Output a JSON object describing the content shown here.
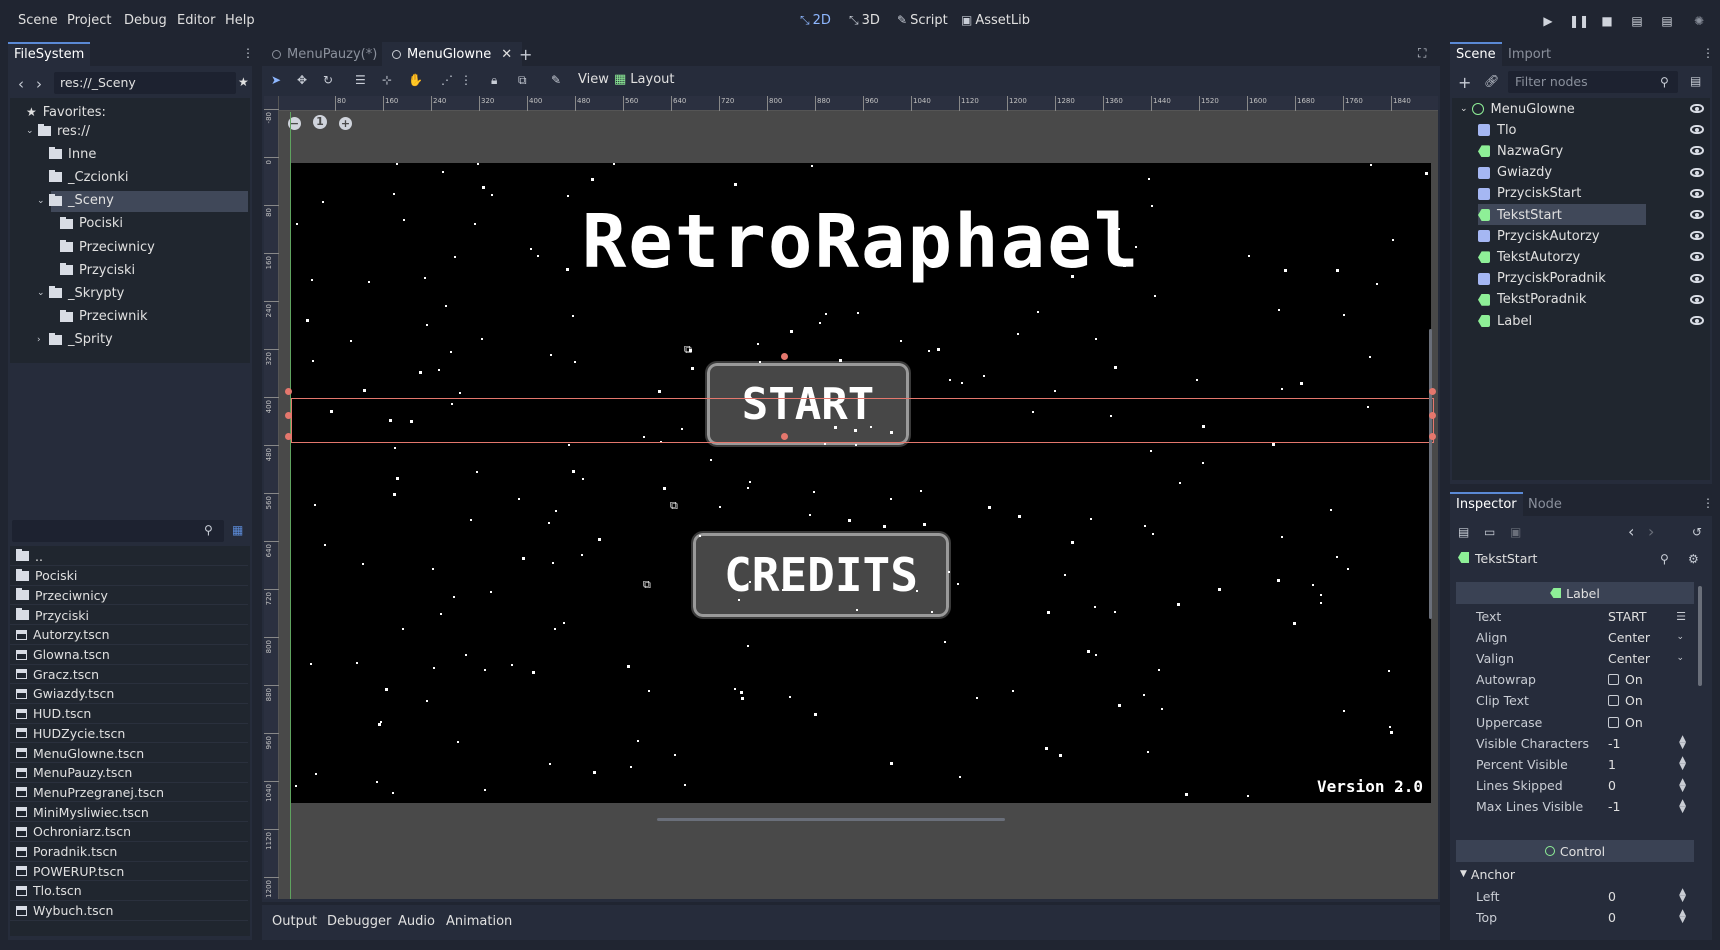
{
  "menu": [
    "Scene",
    "Project",
    "Debug",
    "Editor",
    "Help"
  ],
  "modes": [
    {
      "label": "2D",
      "icon": "2d-icon",
      "active": true
    },
    {
      "label": "3D",
      "icon": "3d-icon",
      "active": false
    },
    {
      "label": "Script",
      "icon": "script-icon",
      "active": false
    },
    {
      "label": "AssetLib",
      "icon": "assetlib-icon",
      "active": false
    }
  ],
  "filesystem": {
    "tab_label": "FileSystem",
    "path": "res://_Sceny",
    "favorites_label": "Favorites:",
    "tree": [
      {
        "label": "res://",
        "depth": 0,
        "expanded": true
      },
      {
        "label": "Inne",
        "depth": 1
      },
      {
        "label": "_Czcionki",
        "depth": 1
      },
      {
        "label": "_Sceny",
        "depth": 1,
        "expanded": true,
        "selected": true
      },
      {
        "label": "Pociski",
        "depth": 2
      },
      {
        "label": "Przeciwnicy",
        "depth": 2
      },
      {
        "label": "Przyciski",
        "depth": 2
      },
      {
        "label": "_Skrypty",
        "depth": 1,
        "expanded": true
      },
      {
        "label": "Przeciwnik",
        "depth": 2
      },
      {
        "label": "_Sprity",
        "depth": 1,
        "collapsed": true
      }
    ],
    "files": [
      {
        "label": "..",
        "kind": "folder"
      },
      {
        "label": "Pociski",
        "kind": "folder"
      },
      {
        "label": "Przeciwnicy",
        "kind": "folder"
      },
      {
        "label": "Przyciski",
        "kind": "folder"
      },
      {
        "label": "Autorzy.tscn",
        "kind": "scene"
      },
      {
        "label": "Glowna.tscn",
        "kind": "scene"
      },
      {
        "label": "Gracz.tscn",
        "kind": "scene"
      },
      {
        "label": "Gwiazdy.tscn",
        "kind": "scene"
      },
      {
        "label": "HUD.tscn",
        "kind": "scene"
      },
      {
        "label": "HUDZycie.tscn",
        "kind": "scene"
      },
      {
        "label": "MenuGlowne.tscn",
        "kind": "scene"
      },
      {
        "label": "MenuPauzy.tscn",
        "kind": "scene"
      },
      {
        "label": "MenuPrzegranej.tscn",
        "kind": "scene"
      },
      {
        "label": "MiniMysliwiec.tscn",
        "kind": "scene"
      },
      {
        "label": "Ochroniarz.tscn",
        "kind": "scene"
      },
      {
        "label": "Poradnik.tscn",
        "kind": "scene"
      },
      {
        "label": "POWERUP.tscn",
        "kind": "scene"
      },
      {
        "label": "Tlo.tscn",
        "kind": "scene"
      },
      {
        "label": "Wybuch.tscn",
        "kind": "scene"
      }
    ]
  },
  "editor_tabs": [
    {
      "label": "MenuPauzy(*)",
      "active": false
    },
    {
      "label": "MenuGlowne",
      "active": true
    }
  ],
  "toolbar": {
    "view_label": "View",
    "layout_label": "Layout"
  },
  "ruler_top": [
    "80",
    "160",
    "240",
    "320",
    "400",
    "480",
    "560",
    "640",
    "720",
    "800",
    "880",
    "960",
    "1040",
    "1120",
    "1200",
    "1280",
    "1360",
    "1440",
    "1520",
    "1600",
    "1680",
    "1760",
    "1840"
  ],
  "ruler_left": [
    "-80",
    "0",
    "80",
    "160",
    "240",
    "320",
    "400",
    "480",
    "560",
    "640",
    "720",
    "800",
    "880",
    "960",
    "1040",
    "1120",
    "1200"
  ],
  "zoom": {
    "reset_label": "1"
  },
  "game": {
    "title": "RetroRaphael",
    "start_label": "START",
    "credits_label": "CREDITS",
    "version": "Version 2.0"
  },
  "bottom_tabs": [
    "Output",
    "Debugger",
    "Audio",
    "Animation"
  ],
  "scene_panel": {
    "tabs": [
      "Scene",
      "Import"
    ],
    "filter_placeholder": "Filter nodes",
    "nodes": [
      {
        "label": "MenuGlowne",
        "type": "control-icon",
        "color": "#8eef97",
        "depth": 0
      },
      {
        "label": "Tlo",
        "type": "texture-rect-icon",
        "color": "#a5b7f3",
        "depth": 1
      },
      {
        "label": "NazwaGry",
        "type": "label-icon",
        "color": "#8eef97",
        "depth": 1
      },
      {
        "label": "Gwiazdy",
        "type": "particles-icon",
        "color": "#a5b7f3",
        "depth": 1
      },
      {
        "label": "PrzyciskStart",
        "type": "texture-button-icon",
        "color": "#a5b7f3",
        "depth": 1
      },
      {
        "label": "TekstStart",
        "type": "label-icon",
        "color": "#8eef97",
        "depth": 1,
        "selected": true
      },
      {
        "label": "PrzyciskAutorzy",
        "type": "texture-button-icon",
        "color": "#a5b7f3",
        "depth": 1
      },
      {
        "label": "TekstAutorzy",
        "type": "label-icon",
        "color": "#8eef97",
        "depth": 1
      },
      {
        "label": "PrzyciskPoradnik",
        "type": "texture-button-icon",
        "color": "#a5b7f3",
        "depth": 1
      },
      {
        "label": "TekstPoradnik",
        "type": "label-icon",
        "color": "#8eef97",
        "depth": 1
      },
      {
        "label": "Label",
        "type": "label-icon",
        "color": "#8eef97",
        "depth": 1
      }
    ]
  },
  "inspector": {
    "tabs": [
      "Inspector",
      "Node"
    ],
    "object_name": "TekstStart",
    "section_label": "Label",
    "section_control": "Control",
    "group_anchor": "Anchor",
    "properties": [
      {
        "name": "Text",
        "value": "START",
        "kind": "text"
      },
      {
        "name": "Align",
        "value": "Center",
        "kind": "enum"
      },
      {
        "name": "Valign",
        "value": "Center",
        "kind": "enum"
      },
      {
        "name": "Autowrap",
        "value": "On",
        "kind": "check"
      },
      {
        "name": "Clip Text",
        "value": "On",
        "kind": "check"
      },
      {
        "name": "Uppercase",
        "value": "On",
        "kind": "check"
      },
      {
        "name": "Visible Characters",
        "value": "-1",
        "kind": "spin"
      },
      {
        "name": "Percent Visible",
        "value": "1",
        "kind": "spin"
      },
      {
        "name": "Lines Skipped",
        "value": "0",
        "kind": "spin"
      },
      {
        "name": "Max Lines Visible",
        "value": "-1",
        "kind": "spin"
      }
    ],
    "anchor_props": [
      {
        "name": "Left",
        "value": "0"
      },
      {
        "name": "Top",
        "value": "0"
      }
    ]
  },
  "colors": {
    "accent": "#5b8ad6",
    "selection": "#404859",
    "bg_dark": "#202531",
    "panel": "#262c3b"
  }
}
